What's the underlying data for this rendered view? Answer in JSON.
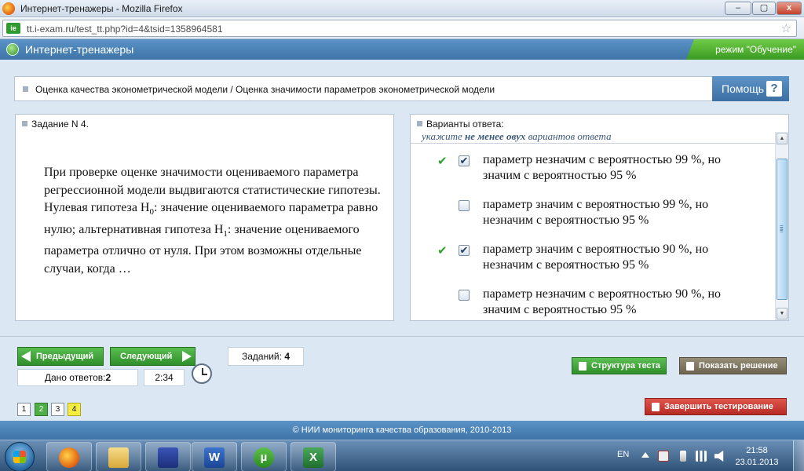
{
  "window": {
    "title": "Интернет-тренажеры - Mozilla Firefox",
    "btn_minimize": "–",
    "btn_maximize": "▢",
    "btn_close": "x"
  },
  "browser": {
    "url": "tt.i-exam.ru/test_tt.php?id=4&tsid=1358964581",
    "star": "☆",
    "site_icon": "ie"
  },
  "app": {
    "title": "Интернет-тренажеры",
    "mode": "режим \"Обучение\""
  },
  "breadcrumb": "Оценка качества эконометрической модели / Оценка значимости параметров эконометрической модели",
  "help": {
    "label": "Помощь",
    "icon": "?"
  },
  "task": {
    "header": "Задание N 4.",
    "text_part1": "При проверке оценке значимости оцениваемого параметра регрессионной модели выдвигаются статистические гипотезы. Нулевая гипотеза H",
    "sub0": "0",
    "text_part2": ": значение оцениваемого параметра равно нулю; альтернативная гипотеза H",
    "sub1": "1",
    "text_part3": ": значение оцениваемого параметра отлично от нуля. При этом возможны отдельные случаи, когда …"
  },
  "answers_panel": {
    "header": "Варианты ответа:",
    "hint_a": "укажите ",
    "hint_b": "не менее овух",
    "hint_c": " вариантов ответа",
    "items": [
      {
        "text": "параметр незначим с вероятностью 99 %, но значим с вероятностью 95 %",
        "checked": "✔",
        "mark": "✔"
      },
      {
        "text": "параметр значим с вероятностью 99 %, но незначим с вероятностью 95 %",
        "checked": "",
        "mark": ""
      },
      {
        "text": "параметр значим с вероятностью 90 %, но незначим с вероятностью 95 %",
        "checked": "✔",
        "mark": "✔"
      },
      {
        "text": "параметр незначим с вероятностью 90 %, но значим с вероятностью 95 %",
        "checked": "",
        "mark": ""
      }
    ]
  },
  "nav": {
    "prev": "Предыдущий",
    "next": "Следующий",
    "tasks_label": "Заданий:",
    "tasks_count": "4",
    "answered_label": "Дано ответов:",
    "answered_count": "2",
    "timer": "2:34",
    "pages": [
      "1",
      "2",
      "3",
      "4"
    ]
  },
  "actions": {
    "structure": "Структура теста",
    "show_solution": "Показать решение",
    "finish": "Завершить тестирование"
  },
  "footer": "© НИИ мониторинга качества образования, 2010-2013",
  "taskbar": {
    "apps": [
      {
        "name": "firefox",
        "glyph": ""
      },
      {
        "name": "explorer",
        "glyph": ""
      },
      {
        "name": "save",
        "glyph": ""
      },
      {
        "name": "word",
        "glyph": "W"
      },
      {
        "name": "utorrent",
        "glyph": "µ"
      },
      {
        "name": "excel",
        "glyph": "X"
      }
    ],
    "lang": "EN",
    "time": "21:58",
    "date": "23.01.2013"
  }
}
